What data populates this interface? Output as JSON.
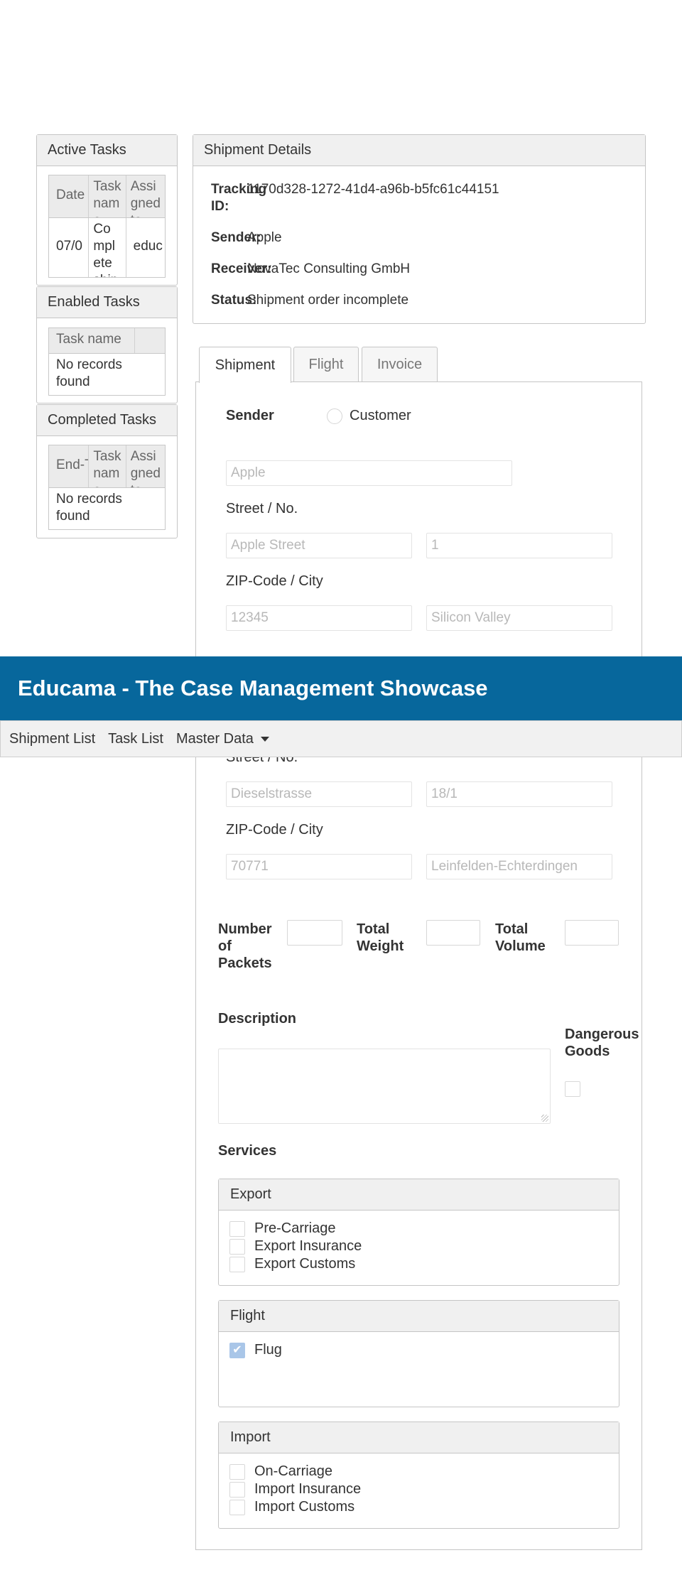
{
  "active_tasks": {
    "title": "Active Tasks",
    "columns": [
      "Date",
      "Task name",
      "Assigned to"
    ],
    "rows": [
      {
        "date": "07/0",
        "task": "Complete shipment order",
        "assigned": "educ"
      }
    ]
  },
  "enabled_tasks": {
    "title": "Enabled Tasks",
    "columns": [
      "Task name",
      ""
    ],
    "empty": "No records found"
  },
  "completed_tasks": {
    "title": "Completed Tasks",
    "columns": [
      "End-Time",
      "Task name",
      "Assigned to"
    ],
    "empty": "No records found"
  },
  "shipment_details": {
    "title": "Shipment Details",
    "tracking_label": "Tracking ID:",
    "tracking_value": "1170d328-1272-41d4-a96b-b5fc61c44151",
    "sender_label": "Sender:",
    "sender_value": "Apple",
    "receiver_label": "Receiver:",
    "receiver_value": "NovaTec Consulting GmbH",
    "status_label": "Status:",
    "status_value": "Shipment order incomplete"
  },
  "tabs": [
    "Shipment",
    "Flight",
    "Invoice"
  ],
  "sender_form": {
    "label": "Sender",
    "customer_radio": "Customer",
    "name_value": "Apple",
    "street_label": "Street / No.",
    "street_value": "Apple Street",
    "number_value": "1",
    "zip_label": "ZIP-Code / City",
    "zip_value": "12345",
    "city_value": "Silicon Valley"
  },
  "receiver_form": {
    "street_label": "Street / No.",
    "street_value": "Dieselstrasse",
    "number_value": "18/1",
    "zip_label": "ZIP-Code / City",
    "zip_value": "70771",
    "city_value": "Leinfelden-Echterdingen"
  },
  "metrics": {
    "packets_label": "Number of Packets",
    "weight_label": "Total Weight",
    "volume_label": "Total Volume"
  },
  "description_label": "Description",
  "dangerous_goods_label": "Dangerous Goods",
  "services_label": "Services",
  "services": {
    "export": {
      "title": "Export",
      "items": [
        "Pre-Carriage",
        "Export Insurance",
        "Export Customs"
      ]
    },
    "flight": {
      "title": "Flight",
      "items": [
        "Flug"
      ]
    },
    "import": {
      "title": "Import",
      "items": [
        "On-Carriage",
        "Import Insurance",
        "Import Customs"
      ]
    }
  },
  "header": {
    "title": "Educama - The Case Management Showcase",
    "nav": [
      "Shipment List",
      "Task List",
      "Master Data"
    ]
  },
  "colors": {
    "header_bg": "#07679c",
    "checked": "#a9c6e8"
  }
}
